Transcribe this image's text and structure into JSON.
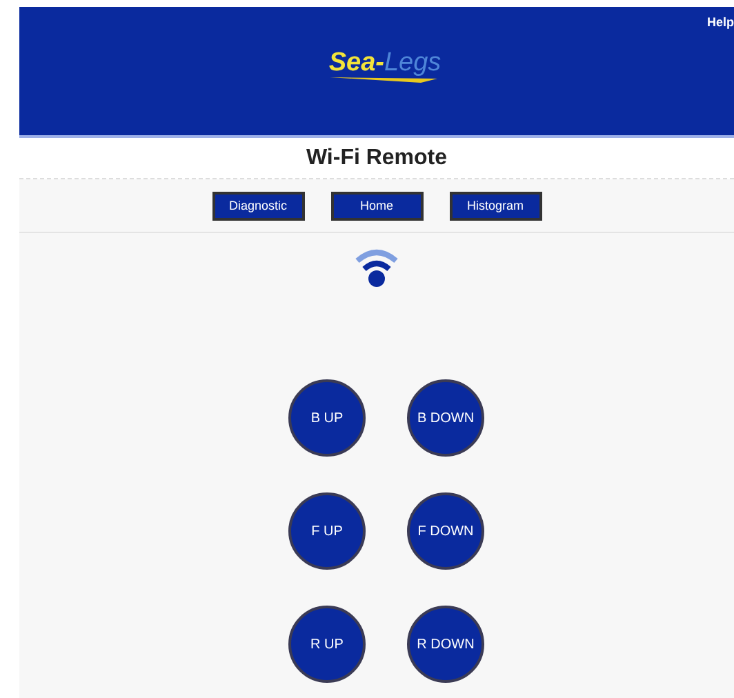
{
  "header": {
    "logo": {
      "part_1": "Sea-",
      "part_2": "Legs"
    },
    "help_link": "Help"
  },
  "title": "Wi-Fi Remote",
  "nav": [
    "Diagnostic",
    "Home",
    "Histogram"
  ],
  "controls": [
    [
      "B UP",
      "B DOWN"
    ],
    [
      "F UP",
      "F DOWN"
    ],
    [
      "R UP",
      "R DOWN"
    ]
  ]
}
